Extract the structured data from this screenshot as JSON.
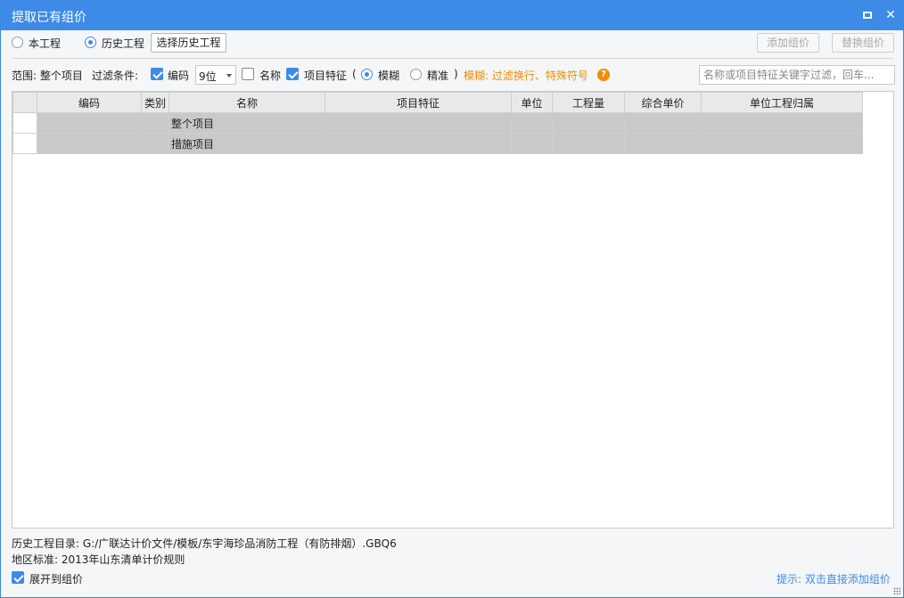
{
  "window": {
    "title": "提取已有组价"
  },
  "toolbar": {
    "radio_current": "本工程",
    "radio_history": "历史工程",
    "select_history_btn": "选择历史工程",
    "add_btn": "添加组价",
    "replace_btn": "替换组价"
  },
  "filter": {
    "scope_label": "范围: 整个项目",
    "condition_label": "过滤条件:",
    "code_label": "编码",
    "code_digits": "9位",
    "name_label": "名称",
    "feature_label": "项目特征",
    "paren_open": "(",
    "fuzzy_label": "模糊",
    "exact_label": "精准",
    "paren_close": ")",
    "fuzzy_tip": "模糊: 过滤换行、特殊符号",
    "help_glyph": "?",
    "search_placeholder": "名称或项目特征关键字过滤，回车..."
  },
  "grid": {
    "columns": [
      "编码",
      "类别",
      "名称",
      "项目特征",
      "单位",
      "工程量",
      "综合单价",
      "单位工程归属"
    ],
    "rows": [
      {
        "code": "",
        "type": "",
        "name": "整个项目",
        "feature": "",
        "unit": "",
        "qty": "",
        "price": "",
        "belong": ""
      },
      {
        "code": "",
        "type": "",
        "name": "措施项目",
        "feature": "",
        "unit": "",
        "qty": "",
        "price": "",
        "belong": ""
      }
    ]
  },
  "footer": {
    "history_dir": "历史工程目录: G:/广联达计价文件/模板/东宇海珍品消防工程（有防排烟）.GBQ6",
    "region_standard": "地区标准: 2013年山东清单计价规则",
    "expand_label": "展开到组价",
    "hint": "提示: 双击直接添加组价"
  },
  "colors": {
    "accent": "#3d8be6",
    "warning": "#f08c00"
  }
}
